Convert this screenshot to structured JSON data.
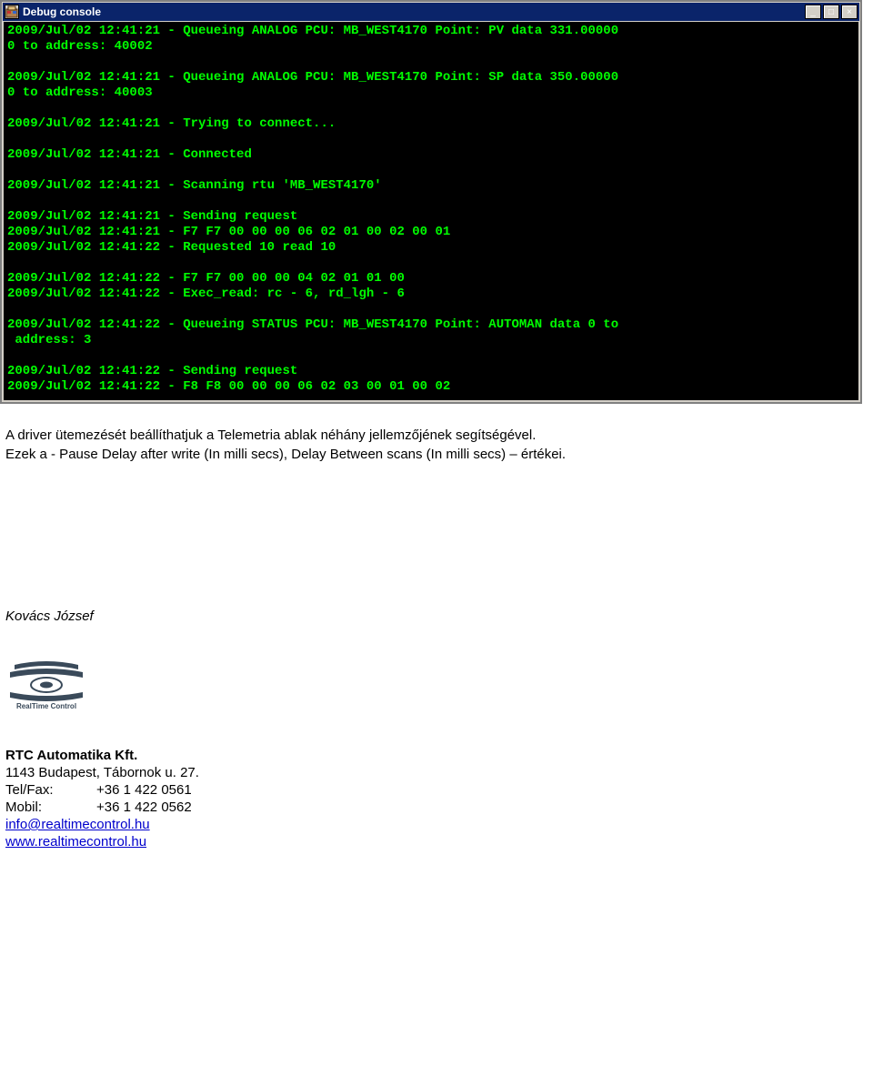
{
  "console": {
    "title": "Debug console",
    "lines": [
      "2009/Jul/02 12:41:21 - Queueing ANALOG PCU: MB_WEST4170 Point: PV data 331.00000",
      "0 to address: 40002",
      "",
      "2009/Jul/02 12:41:21 - Queueing ANALOG PCU: MB_WEST4170 Point: SP data 350.00000",
      "0 to address: 40003",
      "",
      "2009/Jul/02 12:41:21 - Trying to connect...",
      "",
      "2009/Jul/02 12:41:21 - Connected",
      "",
      "2009/Jul/02 12:41:21 - Scanning rtu 'MB_WEST4170'",
      "",
      "2009/Jul/02 12:41:21 - Sending request",
      "2009/Jul/02 12:41:21 - F7 F7 00 00 00 06 02 01 00 02 00 01",
      "2009/Jul/02 12:41:22 - Requested 10 read 10",
      "",
      "2009/Jul/02 12:41:22 - F7 F7 00 00 00 04 02 01 01 00",
      "2009/Jul/02 12:41:22 - Exec_read: rc - 6, rd_lgh - 6",
      "",
      "2009/Jul/02 12:41:22 - Queueing STATUS PCU: MB_WEST4170 Point: AUTOMAN data 0 to",
      " address: 3",
      "",
      "2009/Jul/02 12:41:22 - Sending request",
      "2009/Jul/02 12:41:22 - F8 F8 00 00 00 06 02 03 00 01 00 02"
    ]
  },
  "body": {
    "p1": "A driver ütemezését beállíthatjuk a Telemetria ablak néhány jellemzőjének segítségével.",
    "p2": "Ezek a - Pause Delay after write (In milli secs), Delay Between scans (In milli secs) – értékei."
  },
  "signature": "Kovács József",
  "logo_caption": "RealTime Control",
  "contact": {
    "company": "RTC Automatika Kft.",
    "address": "1143 Budapest, Tábornok u. 27.",
    "telfax_label": "Tel/Fax:",
    "telfax": "+36 1 422 0561",
    "mobil_label": "Mobil:",
    "mobil": "+36 1 422 0562",
    "email": "info@realtimecontrol.hu",
    "web": "www.realtimecontrol.hu"
  },
  "win_buttons": {
    "minimize": "_",
    "maximize": "□",
    "close": "×"
  }
}
